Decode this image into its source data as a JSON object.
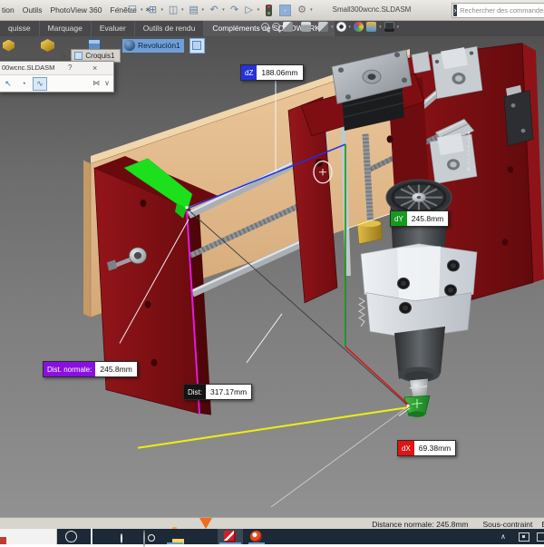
{
  "titlebar": {
    "menus": [
      "tion",
      "Outils",
      "PhotoView 360",
      "Fenêtre"
    ],
    "pin_glyph": "∗",
    "toolbar_icons": [
      {
        "name": "home",
        "glyph": "⌂"
      },
      {
        "name": "new-document",
        "glyph": "☐"
      },
      {
        "name": "open",
        "glyph": "⊞"
      },
      {
        "name": "save",
        "glyph": "◫"
      },
      {
        "name": "print",
        "glyph": "▤"
      },
      {
        "name": "undo",
        "glyph": "↶"
      },
      {
        "name": "redo",
        "glyph": "↷"
      },
      {
        "name": "select",
        "glyph": "▷"
      }
    ],
    "gear_glyph": "⚙",
    "title": "Small300wcnc.SLDASM",
    "search_placeholder": "Rechercher des commandes",
    "search_icon_glyph": "›"
  },
  "ribbon": {
    "tabs": [
      "quisse",
      "Marquage",
      "Evaluer",
      "Outils de rendu",
      "Compléments de SOLIDWORKS"
    ],
    "render_tool_icons": [
      "zoom-out",
      "zoom-in",
      "edit-appearance",
      "copy-appearance",
      "eraser",
      "display-settings",
      "appearance-ball",
      "scene",
      "integrated-preview"
    ]
  },
  "viewport": {
    "breadcrumb": {
      "feature": "Revolución1",
      "sketch_button": "Croquis1",
      "branch_glyph": "↳"
    },
    "measure_dialog": {
      "title": "00wcnc.SLDASM",
      "help_glyph": "?",
      "close_glyph": "×",
      "icon_names": [
        "selection-filter",
        "measure-units",
        "measure-history"
      ],
      "icon_glyphs": [
        "↖",
        "◔",
        "∿"
      ],
      "pin_glyph": "⋈",
      "collapse_glyph": "∨"
    },
    "measurements": {
      "dz": {
        "label": "dZ",
        "value": "188.06mm",
        "color": "#2633d8"
      },
      "dy": {
        "label": "dY",
        "value": "245.8mm",
        "color": "#149a1e"
      },
      "dist_normal": {
        "label": "Dist. normale:",
        "value": "245.8mm",
        "color": "#8a10e0"
      },
      "dist": {
        "label": "Dist:",
        "value": "317.17mm",
        "color": "#141414"
      },
      "dx": {
        "label": "dX",
        "value": "69.38mm",
        "color": "#e01414"
      }
    }
  },
  "statusbar": {
    "distance": "Distance normale: 245.8mm",
    "state": "Sous-contraint",
    "partial": "E"
  },
  "taskbar": {
    "icon_names": [
      "cortana",
      "task-view",
      "chrome",
      "media-app",
      "file-explorer",
      "download-funnel",
      "solidworks",
      "browser"
    ],
    "tray_chevron": "∧"
  }
}
